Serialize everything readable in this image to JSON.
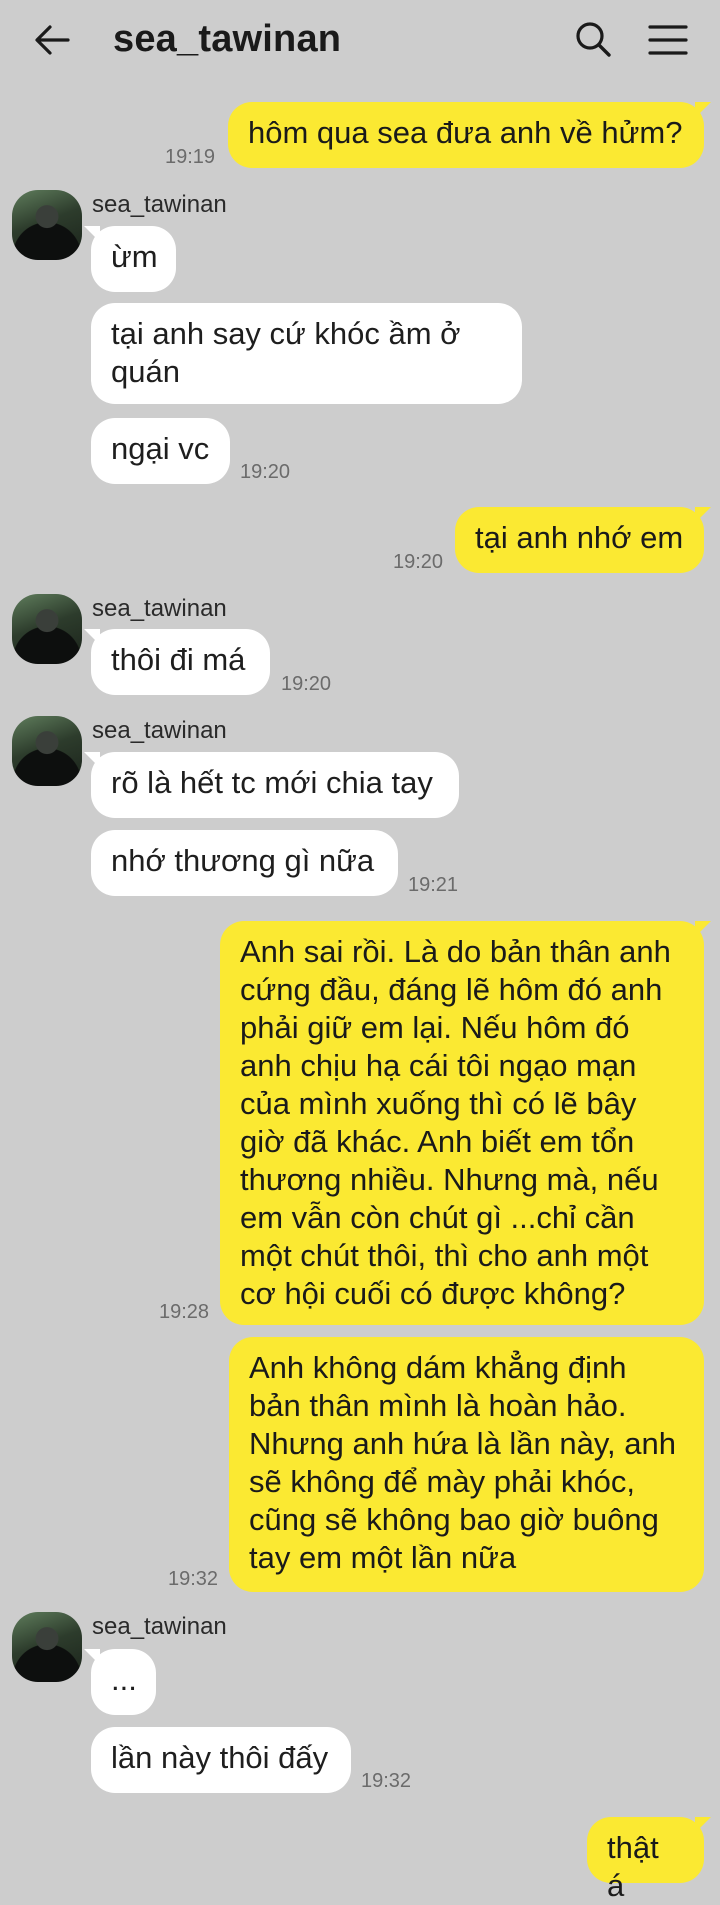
{
  "header": {
    "title": "sea_tawinan"
  },
  "contact_name": "sea_tawinan",
  "messages": {
    "m1": {
      "text": "hôm qua sea đưa anh về hửm?",
      "time": "19:19"
    },
    "m2": {
      "text": "ừm"
    },
    "m3": {
      "text": "tại anh say cứ khóc ầm ở\nquán"
    },
    "m4": {
      "text": "ngại vc",
      "time": "19:20"
    },
    "m5": {
      "text": "tại anh nhớ em",
      "time": "19:20"
    },
    "m6": {
      "text": "thôi đi má",
      "time": "19:20"
    },
    "m7": {
      "text": "rõ là hết tc mới chia tay"
    },
    "m8": {
      "text": "nhớ thương gì nữa",
      "time": "19:21"
    },
    "m9": {
      "text": "Anh sai rồi. Là do bản thân anh\ncứng đầu, đáng lẽ hôm đó anh\nphải giữ em lại. Nếu hôm đó\nanh chịu hạ cái tôi ngạo mạn\ncủa mình xuống thì có lẽ bây\ngiờ đã khác. Anh biết em tổn\nthương nhiều. Nhưng mà, nếu\nem vẫn còn chút gì ...chỉ cần\nmột chút thôi, thì cho anh một\ncơ hội cuối có được không?",
      "time": "19:28"
    },
    "m10": {
      "text": "Anh không dám khẳng định\nbản thân mình là hoàn hảo.\nNhưng anh hứa là lần này, anh\nsẽ không để mày phải khóc,\ncũng sẽ không bao giờ buông\ntay em một lần nữa",
      "time": "19:32"
    },
    "m11": {
      "text": "..."
    },
    "m12": {
      "text": "lần này thôi đấy",
      "time": "19:32"
    },
    "m13": {
      "text": "thật á"
    }
  },
  "colors": {
    "background": "#cdcdcd",
    "outgoing_bubble": "#fbe932",
    "incoming_bubble": "#ffffff"
  },
  "icons": [
    "back-arrow-icon",
    "search-icon",
    "menu-icon"
  ]
}
